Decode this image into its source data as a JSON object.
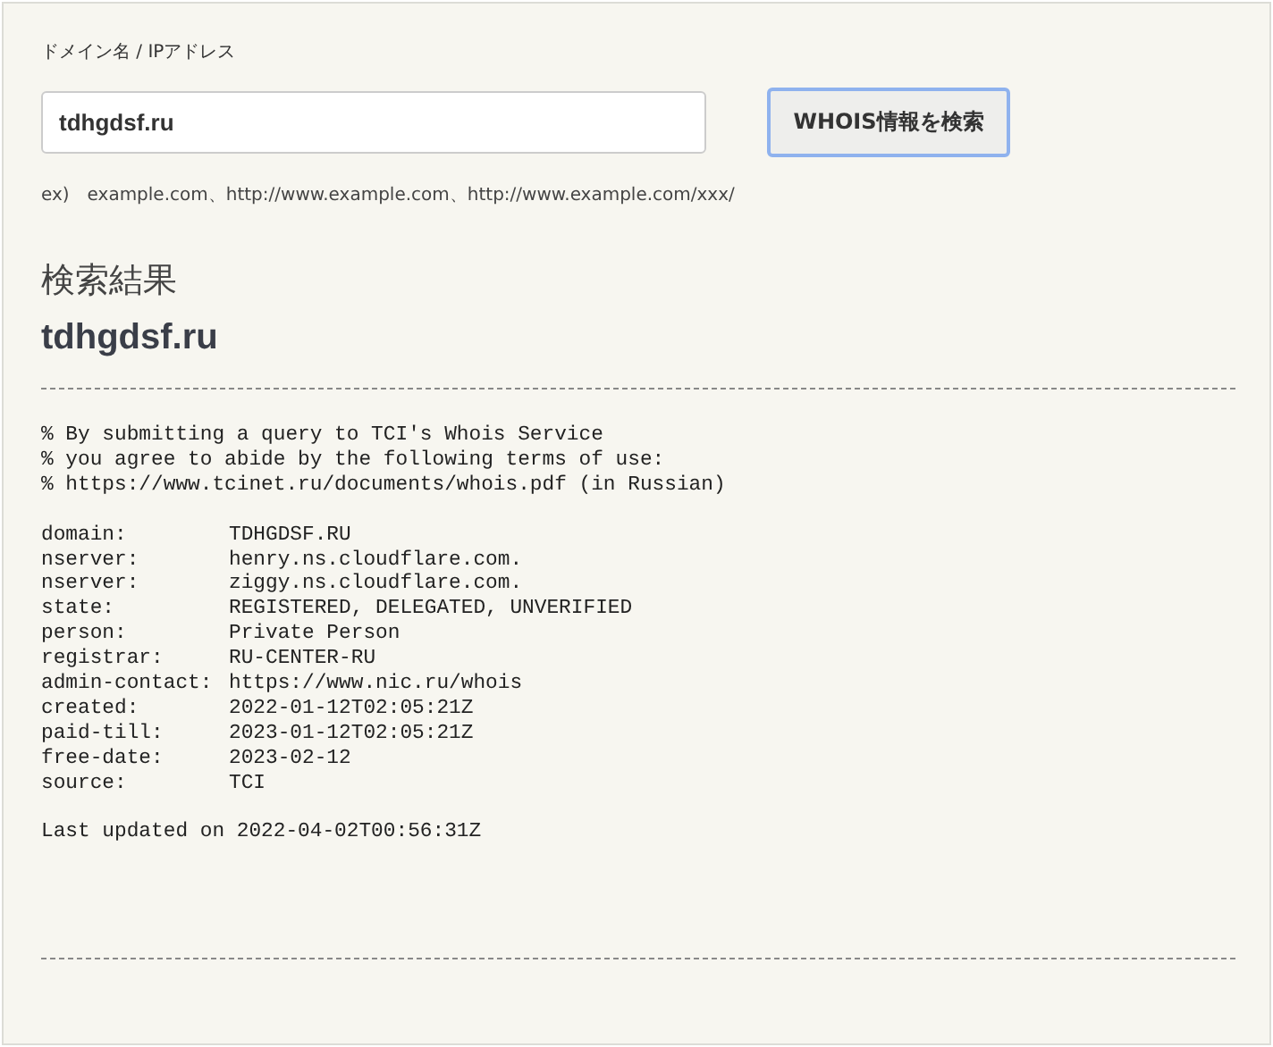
{
  "form": {
    "label": "ドメイン名 / IPアドレス",
    "value": "tdhgdsf.ru",
    "button": "WHOIS情報を検索",
    "example": "ex)　example.com、http://www.example.com、http://www.example.com/xxx/"
  },
  "results": {
    "heading": "検索結果",
    "domain": "tdhgdsf.ru",
    "notice": [
      "% By submitting a query to TCI's Whois Service",
      "% you agree to abide by the following terms of use:",
      "% https://www.tcinet.ru/documents/whois.pdf (in Russian)"
    ],
    "records": [
      {
        "key": "domain:",
        "value": "TDHGDSF.RU"
      },
      {
        "key": "nserver:",
        "value": "henry.ns.cloudflare.com."
      },
      {
        "key": "nserver:",
        "value": "ziggy.ns.cloudflare.com."
      },
      {
        "key": "state:",
        "value": "REGISTERED, DELEGATED, UNVERIFIED"
      },
      {
        "key": "person:",
        "value": "Private Person"
      },
      {
        "key": "registrar:",
        "value": "RU-CENTER-RU"
      },
      {
        "key": "admin-contact:",
        "value": "https://www.nic.ru/whois"
      },
      {
        "key": "created:",
        "value": "2022-01-12T02:05:21Z"
      },
      {
        "key": "paid-till:",
        "value": "2023-01-12T02:05:21Z"
      },
      {
        "key": "free-date:",
        "value": "2023-02-12"
      },
      {
        "key": "source:",
        "value": "TCI"
      }
    ],
    "footer": "Last updated on 2022-04-02T00:56:31Z"
  }
}
